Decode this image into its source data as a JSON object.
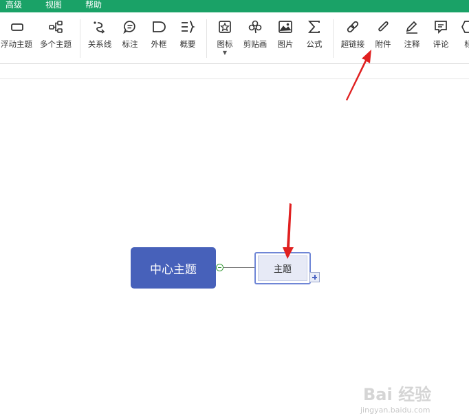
{
  "menubar": {
    "items": [
      {
        "label": "高级"
      },
      {
        "label": "视图"
      },
      {
        "label": "帮助"
      }
    ]
  },
  "toolbar": {
    "tools": [
      {
        "label": "浮动主题",
        "icon": "floating-topic-icon"
      },
      {
        "label": "多个主题",
        "icon": "multi-topic-icon"
      },
      {
        "label": "关系线",
        "icon": "relationship-icon"
      },
      {
        "label": "标注",
        "icon": "callout-icon"
      },
      {
        "label": "外框",
        "icon": "boundary-icon"
      },
      {
        "label": "概要",
        "icon": "summary-icon"
      },
      {
        "label": "图标",
        "icon": "marker-icon"
      },
      {
        "label": "剪贴画",
        "icon": "clipart-icon"
      },
      {
        "label": "图片",
        "icon": "image-icon"
      },
      {
        "label": "公式",
        "icon": "formula-icon"
      },
      {
        "label": "超链接",
        "icon": "hyperlink-icon"
      },
      {
        "label": "附件",
        "icon": "attachment-icon"
      },
      {
        "label": "注释",
        "icon": "note-icon"
      },
      {
        "label": "评论",
        "icon": "comment-icon"
      },
      {
        "label": "标",
        "icon": "label-icon"
      }
    ]
  },
  "canvas": {
    "central_topic": "中心主题",
    "sub_topic": "主题"
  },
  "watermark": {
    "logo": "Bai 经验",
    "url": "jingyan.baidu.com"
  },
  "colors": {
    "menubar_bg": "#1aa267",
    "central_topic_bg": "#4761ba",
    "topic_border": "#6f86d6",
    "annotation_arrow": "#e02020"
  }
}
